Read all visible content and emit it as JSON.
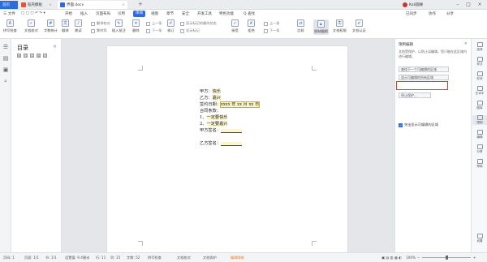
{
  "titlebar": {
    "tabs": [
      {
        "label": "首页",
        "color": "#2d6cdf"
      },
      {
        "label": "稻壳模板",
        "color": "#e8532b"
      },
      {
        "label": "界面.docx",
        "color": "#2d6cdf"
      }
    ],
    "new_tab": "+",
    "user_name": "Kali圆缘"
  },
  "menu": {
    "file": "三 文件",
    "items": [
      "开始",
      "插入",
      "页面布局",
      "引用",
      "审阅",
      "视图",
      "章节",
      "安全",
      "开发工具",
      "特色功能"
    ],
    "active": "审阅",
    "search": "Q 查找",
    "right": [
      "已同步",
      "协作",
      "分享"
    ]
  },
  "toolbar": {
    "buttons": [
      "拼写检查",
      "文档校对",
      "字数统计",
      "翻译",
      "朗读",
      "插入批注",
      "删除",
      "修订",
      "显示标记",
      "接受",
      "拒绝",
      "比较",
      "限制编辑",
      "文档权限",
      "文档认证"
    ],
    "small": {
      "verify": "翻译校对",
      "bind": "繁转简",
      "prev_comment": "上一条",
      "next_comment": "下一条",
      "prev_change": "上一条",
      "next_change": "下一条",
      "markup_view": "显示标记的最终状态",
      "show_markup": "显示标记"
    }
  },
  "toc": {
    "title": "目录",
    "close": "×",
    "tools": [
      "⊞",
      "⊟",
      "⊡",
      "⊞",
      "⊡"
    ]
  },
  "document": {
    "lines": [
      {
        "label": "甲方：",
        "value": "快乐"
      },
      {
        "label": "乙方：",
        "value": "嘉兴"
      },
      {
        "label": "签约日期：",
        "value": "xxxx 年 xx 月 xx 日"
      },
      {
        "label": "合同条款：",
        "value": ""
      },
      {
        "label": "1、",
        "value": "一定要快乐"
      },
      {
        "label": "2、",
        "value": "一定要嘉兴"
      },
      {
        "label": "甲方签名：",
        "value": ""
      },
      {
        "label": "乙方签名：",
        "value": ""
      }
    ]
  },
  "restrict_panel": {
    "title": "限制编辑",
    "close": "×",
    "description": "文档受保护，以防止误编辑。您只能在此区域内进行编辑。",
    "buttons": [
      "查找下一个可编辑的区域",
      "显示可编辑的所有区域"
    ],
    "checkbox_label": "突出显示可编辑的区域",
    "checkbox_checked": true,
    "stop_button": "停止保护..."
  },
  "right_strip": [
    "选择",
    "样式",
    "形状",
    "艺术字",
    "图库",
    "限制",
    "编辑",
    "分享",
    "帮助",
    "设置"
  ],
  "statusbar": {
    "page": "页码: 1",
    "pages": "页面: 1/1",
    "section": "节: 1/1",
    "position": "设置值: 9.4厘米",
    "row": "行: 11",
    "col": "列: 15",
    "words": "字数: 52",
    "spell": "拼写检查",
    "proof": "文档校对",
    "protect": "文档保护",
    "mode": "编辑限制",
    "zoom": "100%",
    "zoom_minus": "−",
    "zoom_plus": "+"
  },
  "colors": {
    "accent": "#2d6cdf",
    "highlight": "#fdf6c8",
    "callout": "#e53935"
  }
}
